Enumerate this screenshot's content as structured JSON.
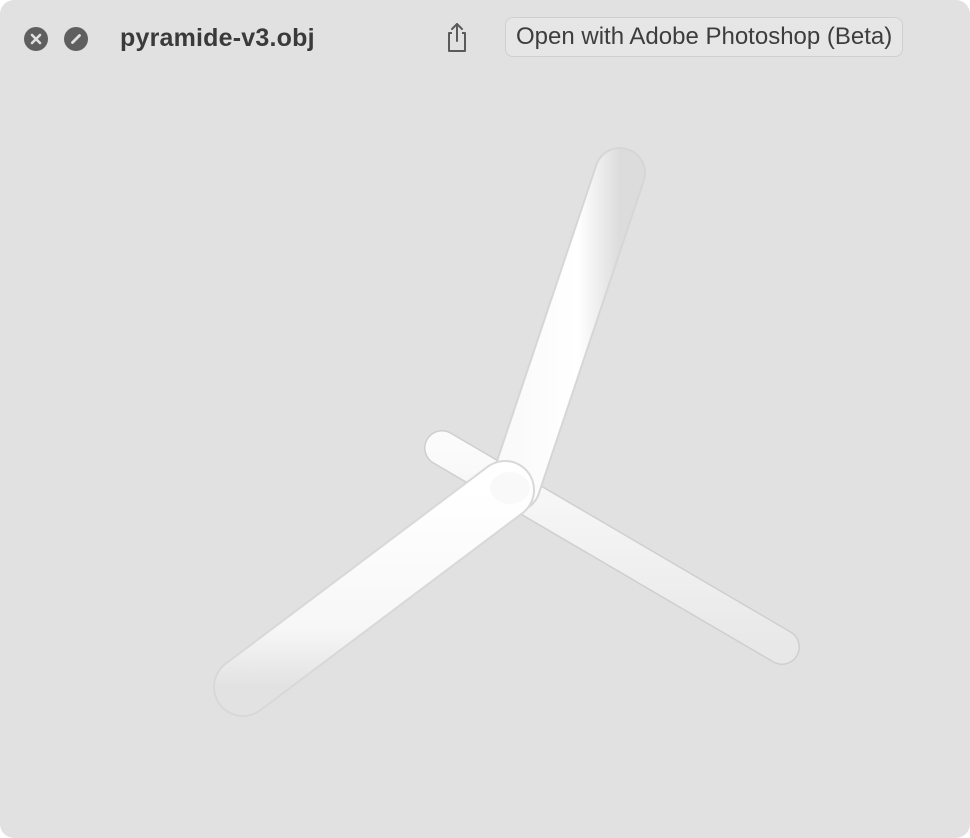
{
  "window": {
    "title": "pyramide-v3.obj",
    "background": "#e1e1e1"
  },
  "toolbar": {
    "close_icon": "close-icon",
    "stop_icon": "stop-icon",
    "share_icon": "share-icon",
    "open_with_label": "Open with Adobe Photoshop (Beta)"
  },
  "viewer": {
    "model_color": "#f6f6f6"
  }
}
